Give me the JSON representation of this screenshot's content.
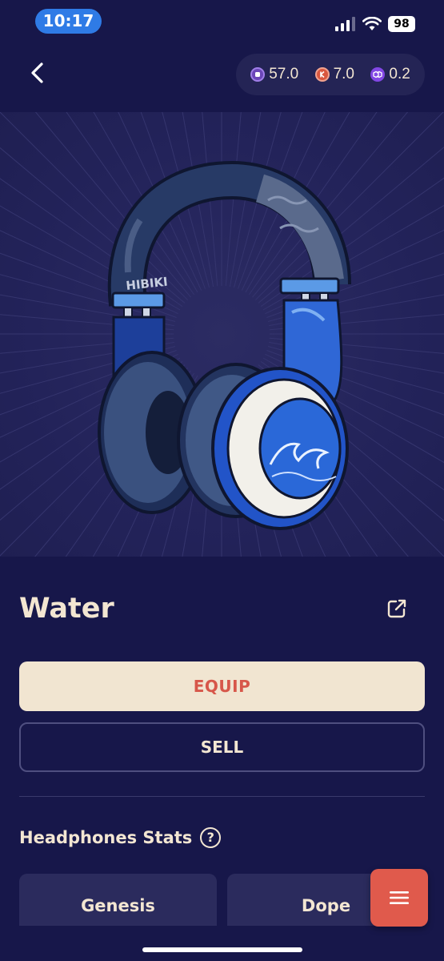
{
  "status": {
    "time": "10:17",
    "battery": "98"
  },
  "balances": [
    {
      "icon": "purple-token-icon",
      "value": "57.0",
      "color": "#7b52c9"
    },
    {
      "icon": "red-token-icon",
      "value": "7.0",
      "color": "#d9573f"
    },
    {
      "icon": "polygon-icon",
      "value": "0.2",
      "color": "#8247e5"
    }
  ],
  "hero": {
    "headband_text": "HIBIKI"
  },
  "item": {
    "name": "Water"
  },
  "actions": {
    "equip_label": "EQUIP",
    "sell_label": "SELL"
  },
  "stats": {
    "heading": "Headphones Stats",
    "help_icon": "?",
    "cards": [
      "Genesis",
      "Dope"
    ]
  }
}
